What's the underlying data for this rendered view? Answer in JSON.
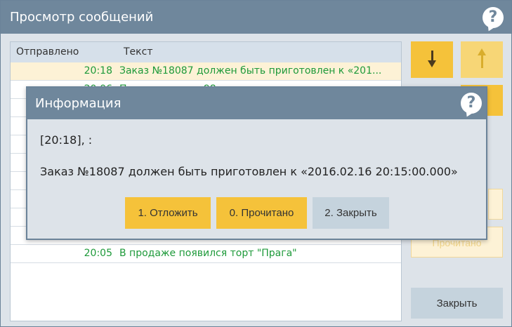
{
  "window": {
    "title": "Просмотр сообщений"
  },
  "list": {
    "columns": [
      "Отправлено",
      "Текст"
    ],
    "rows": [
      {
        "time": "20:18",
        "text": "Заказ №18087 должен быть приготовлен к «201..."
      },
      {
        "time": "20:06",
        "text": "Поступил заказ 98"
      },
      {
        "time": "",
        "text": ""
      },
      {
        "time": "",
        "text": ""
      },
      {
        "time": "",
        "text": ""
      },
      {
        "time": "",
        "text": ""
      },
      {
        "time": "",
        "text": ""
      },
      {
        "time": "",
        "text": ""
      },
      {
        "time": "",
        "text": ""
      },
      {
        "time": "",
        "text": ""
      },
      {
        "time": "20:05",
        "text": "В продаже появился торт \"Прага\""
      }
    ]
  },
  "side": {
    "mark_read_label": "Прочитано",
    "close_label": "Закрыть"
  },
  "dialog": {
    "title": "Информация",
    "line1": "[20:18], :",
    "message": "Заказ №18087 должен быть приготовлен к «2016.02.16 20:15:00.000»",
    "buttons": {
      "defer": "1. Отложить",
      "read": "0. Прочитано",
      "close": "2. Закрыть"
    }
  },
  "colors": {
    "title_bar": "#6f879c",
    "accent": "#f5c23a",
    "message_text": "#1e9a3a"
  }
}
